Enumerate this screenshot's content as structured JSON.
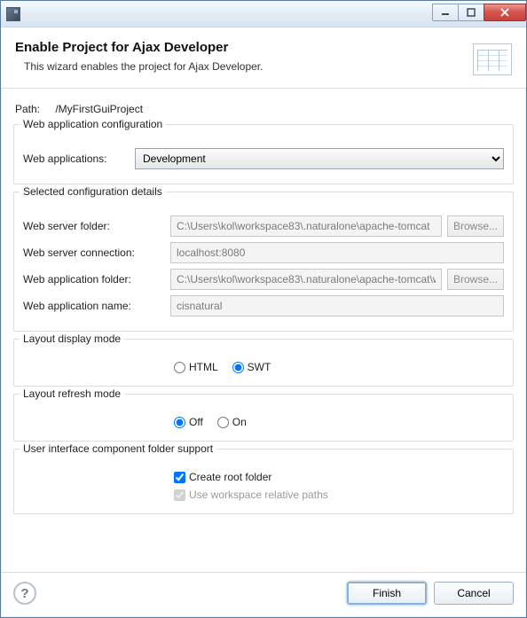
{
  "banner": {
    "title": "Enable Project for Ajax Developer",
    "subtitle": "This wizard enables the project for Ajax Developer."
  },
  "path": {
    "label": "Path:",
    "value": "/MyFirstGuiProject"
  },
  "groups": {
    "web_cfg": {
      "legend": "Web application configuration",
      "web_applications_label": "Web applications:",
      "web_applications_value": "Development"
    },
    "sel_cfg": {
      "legend": "Selected configuration details",
      "server_folder_label": "Web server folder:",
      "server_folder_value": "C:\\Users\\kol\\workspace83\\.naturalone\\apache-tomcat",
      "server_conn_label": "Web server connection:",
      "server_conn_value": "localhost:8080",
      "app_folder_label": "Web application folder:",
      "app_folder_value": "C:\\Users\\kol\\workspace83\\.naturalone\\apache-tomcat\\w",
      "app_name_label": "Web application name:",
      "app_name_value": "cisnatural",
      "browse_label": "Browse..."
    },
    "layout_display": {
      "legend": "Layout display mode",
      "opt_html": "HTML",
      "opt_swt": "SWT"
    },
    "layout_refresh": {
      "legend": "Layout refresh mode",
      "opt_off": "Off",
      "opt_on": "On"
    },
    "ui_folder": {
      "legend": "User interface component folder support",
      "create_root": "Create root folder",
      "use_workspace": "Use workspace relative paths"
    }
  },
  "footer": {
    "finish": "Finish",
    "cancel": "Cancel"
  }
}
